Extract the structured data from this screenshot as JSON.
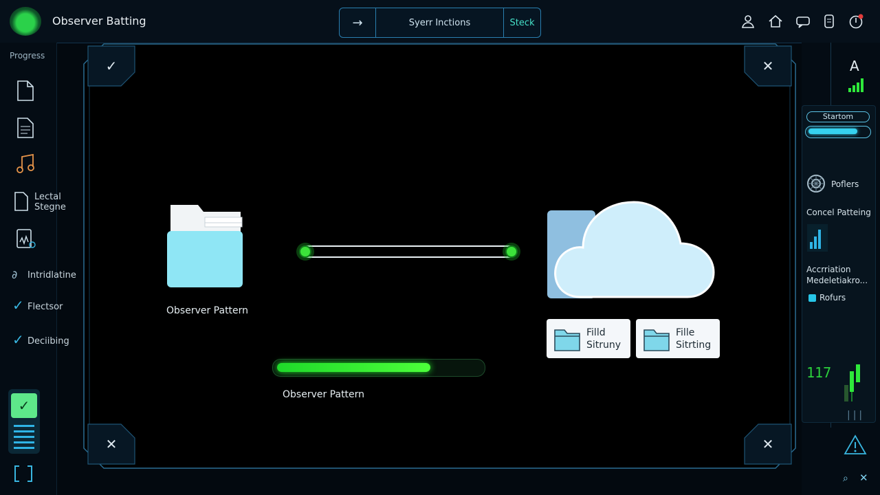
{
  "header": {
    "app_title": "Observer Batting",
    "segments": {
      "arrow": "→",
      "middle": "Syerr Inctions",
      "stack": "Steck"
    },
    "icons": [
      "user-icon",
      "home-icon",
      "chat-icon",
      "device-icon",
      "power-icon"
    ]
  },
  "sidebar": {
    "progress_label": "Progress",
    "items": [
      {
        "icon": "document-icon"
      },
      {
        "icon": "text-document-icon"
      },
      {
        "icon": "music-icon"
      },
      {
        "icon": "file-icon",
        "label": "Lectal\nStegne"
      },
      {
        "icon": "clipboard-icon"
      },
      {
        "icon": "link-icon",
        "label": "Intridlatine"
      },
      {
        "icon": "check-icon",
        "label": "Flectsor"
      },
      {
        "icon": "check-icon",
        "label": "Deciibing"
      }
    ]
  },
  "main": {
    "folder_label": "Observer Pattern",
    "progress_caption": "Observer Pattern",
    "progress": 0.76,
    "cards": [
      {
        "line1": "Filld",
        "line2": "Sitruny"
      },
      {
        "line1": "Fille",
        "line2": "Sitrting"
      }
    ],
    "colors": {
      "accent": "#2fb4e6",
      "success": "#2ee83a",
      "cloud": "#cfeefb"
    }
  },
  "right": {
    "letter": "A",
    "status_label": "Startom",
    "status_progress": 0.85,
    "poflers": "Poflers",
    "concel": "Concel Patteing",
    "accr1": "Accrriation",
    "accr2": "Medeletiakro...",
    "rofurs": "Rofurs",
    "number": "117"
  }
}
